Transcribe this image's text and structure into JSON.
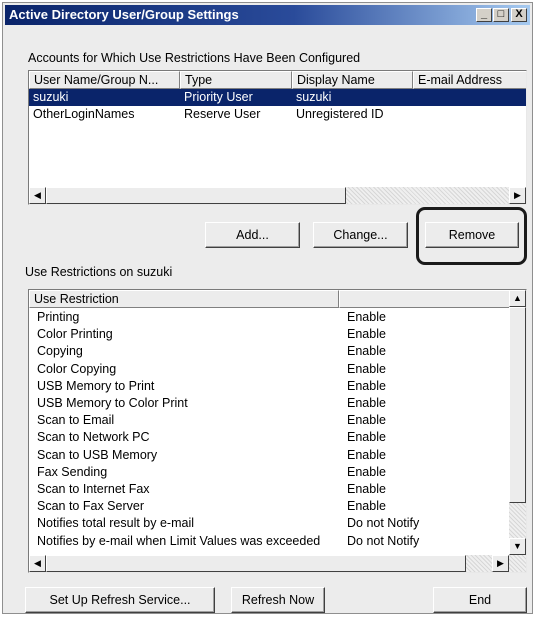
{
  "window": {
    "title": "Active Directory User/Group Settings",
    "controls": {
      "minimize": "_",
      "maximize": "□",
      "close": "X"
    }
  },
  "accounts": {
    "group_label": "Accounts for Which Use Restrictions Have Been Configured",
    "columns": [
      "User Name/Group N...",
      "Type",
      "Display Name",
      "E-mail Address"
    ],
    "rows": [
      {
        "name": "suzuki",
        "type": "Priority User",
        "display": "suzuki",
        "email": "",
        "selected": true
      },
      {
        "name": "OtherLoginNames",
        "type": "Reserve User",
        "display": "Unregistered ID",
        "email": "",
        "selected": false
      }
    ]
  },
  "buttons": {
    "add": "Add...",
    "change": "Change...",
    "remove": "Remove",
    "setup_refresh": "Set Up Refresh Service...",
    "refresh_now": "Refresh Now",
    "end": "End"
  },
  "restrictions": {
    "group_label": "Use Restrictions on suzuki",
    "columns": [
      "Use Restriction",
      ""
    ],
    "rows": [
      {
        "name": "Printing",
        "value": "Enable"
      },
      {
        "name": "Color Printing",
        "value": "Enable"
      },
      {
        "name": "Copying",
        "value": "Enable"
      },
      {
        "name": "Color Copying",
        "value": "Enable"
      },
      {
        "name": "USB Memory to Print",
        "value": "Enable"
      },
      {
        "name": "USB Memory to Color Print",
        "value": "Enable"
      },
      {
        "name": "Scan to Email",
        "value": "Enable"
      },
      {
        "name": "Scan to Network PC",
        "value": "Enable"
      },
      {
        "name": "Scan to USB Memory",
        "value": "Enable"
      },
      {
        "name": "Fax Sending",
        "value": "Enable"
      },
      {
        "name": "Scan to Internet Fax",
        "value": "Enable"
      },
      {
        "name": "Scan to Fax Server",
        "value": "Enable"
      },
      {
        "name": "Notifies total result by e-mail",
        "value": "Do not Notify"
      },
      {
        "name": "Notifies by e-mail when Limit Values was exceeded",
        "value": "Do not Notify"
      }
    ]
  },
  "scroll_glyphs": {
    "left": "◀",
    "right": "▶",
    "up": "▲",
    "down": "▼"
  },
  "colors": {
    "selection": "#0a246a",
    "title_start": "#0a246a",
    "title_end": "#a6caf0"
  }
}
